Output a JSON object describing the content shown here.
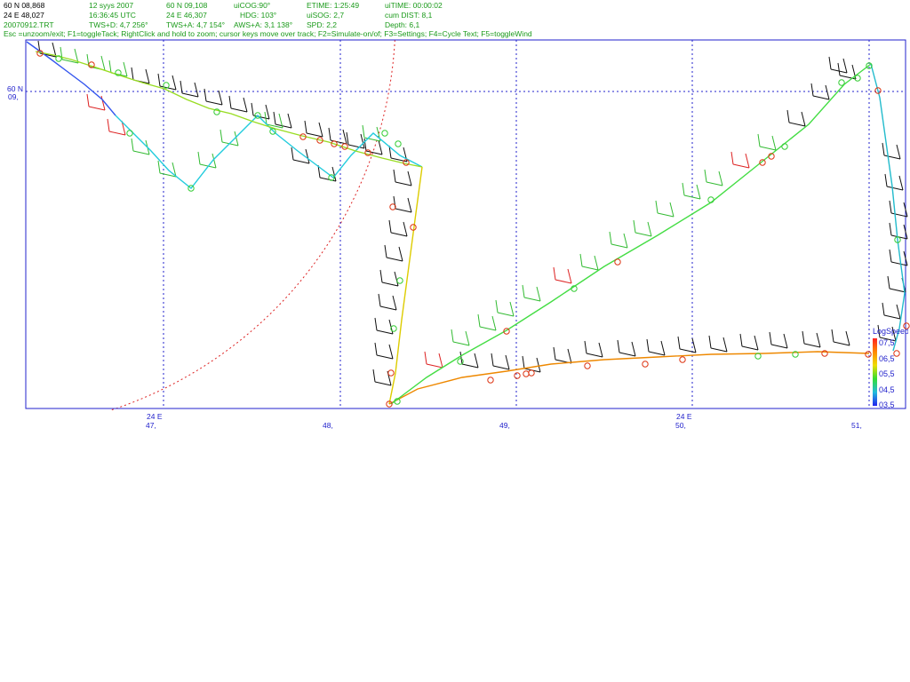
{
  "header": {
    "position": {
      "lat": "60 N 08,868",
      "lon": "24 E 48,027",
      "file": "20070912.TRT"
    },
    "datetime": {
      "date": "12 syys 2007",
      "time": "16:36:45  UTC",
      "tws_d": "TWS+D: 4,7 256°"
    },
    "cursor": {
      "lat": "60 N 09,108",
      "lon": "24 E 46,307",
      "tws_a": "TWS+A: 4,7 154°"
    },
    "course": {
      "cog": "uiCOG:90°",
      "hdg": "HDG: 103°",
      "aws_a": "AWS+A: 3,1 138°"
    },
    "speed": {
      "etime": "ETIME: 1:25:49",
      "sog": "uiSOG: 2,7",
      "spd": "SPD: 2,2"
    },
    "totals": {
      "utime": "uiTIME: 00:00:02",
      "dist": "cum DIST: 8,1",
      "depth": "Depth: 6,1"
    },
    "help": "Esc =unzoom/exit; F1=toggleTack; RightClick and hold to zoom; cursor keys move over track; F2=Simulate-on/of; F3=Settings; F4=Cycle Text; F5=toggleWind"
  },
  "axes": {
    "y_lat_deg": "60 N",
    "y_lat_min": "09,",
    "x_lon_deg": "24 E",
    "x_ticks": [
      "47,",
      "48,",
      "49,",
      "50,",
      "51,"
    ]
  },
  "legend": {
    "title": "LogSpeed",
    "labels": [
      "07,5",
      "06,5",
      "05,5",
      "04,5",
      "03,5"
    ]
  },
  "colors": {
    "frame": "#2222cc",
    "grid": "#2222cc",
    "header_green": "#1a9a1a",
    "circle_red": "#dd3311",
    "circle_green": "#33cc33",
    "wind_black": "#111111",
    "wind_green": "#33bb33",
    "wind_red": "#dd2222",
    "range_circle": "#dd2222"
  }
}
